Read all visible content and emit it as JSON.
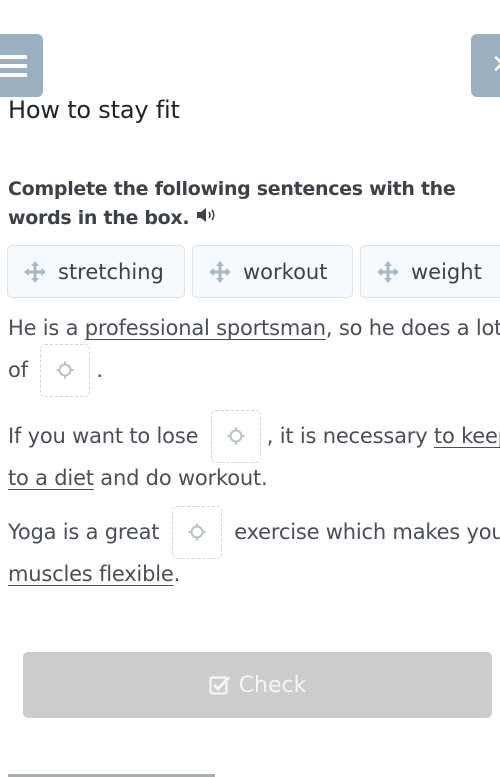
{
  "header": {
    "menu_icon": "hamburger-menu-icon",
    "close_icon": "close-x-icon",
    "close_glyph": "✕",
    "accent_color": "#9aafbf"
  },
  "title": "How to stay fit",
  "instruction": {
    "text": "Complete the following sentences with the words in the box.",
    "audio_icon": "speaker-icon"
  },
  "word_bank": {
    "icon": "move-arrows-icon",
    "words": [
      "stretching",
      "workout",
      "weight"
    ]
  },
  "sentences": [
    {
      "parts": [
        {
          "type": "text",
          "value": "He is a "
        },
        {
          "type": "underline",
          "value": "professional sportsman"
        },
        {
          "type": "text",
          "value": ", so he does a lot of "
        },
        {
          "type": "gap",
          "value": ""
        },
        {
          "type": "text",
          "value": "."
        }
      ]
    },
    {
      "parts": [
        {
          "type": "text",
          "value": "If you want to lose "
        },
        {
          "type": "gap",
          "value": ""
        },
        {
          "type": "text",
          "value": ", it is necessary "
        },
        {
          "type": "underline",
          "value": "to keep to a diet"
        },
        {
          "type": "text",
          "value": " and do workout."
        }
      ]
    },
    {
      "parts": [
        {
          "type": "text",
          "value": "Yoga is a great "
        },
        {
          "type": "gap",
          "value": ""
        },
        {
          "type": "text",
          "value": " exercise which makes your "
        },
        {
          "type": "underline",
          "value": "muscles flexible"
        },
        {
          "type": "text",
          "value": "."
        }
      ]
    }
  ],
  "check_button": {
    "label": "Check",
    "icon": "checkbox-checked-icon",
    "enabled": false
  }
}
